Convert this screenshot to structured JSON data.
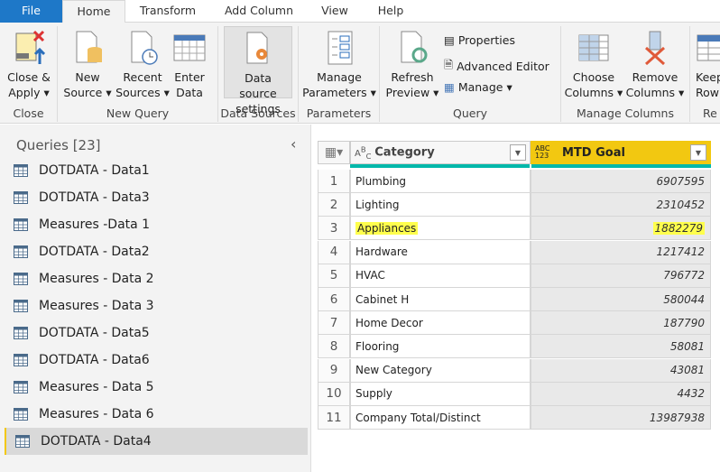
{
  "tabs": [
    "File",
    "Home",
    "Transform",
    "Add Column",
    "View",
    "Help"
  ],
  "ribbon": {
    "close": {
      "label1": "Close &",
      "label2": "Apply",
      "group": "Close"
    },
    "new_query": {
      "group": "New Query",
      "new_source": [
        "New",
        "Source"
      ],
      "recent_sources": [
        "Recent",
        "Sources"
      ],
      "enter_data": [
        "Enter",
        "Data"
      ]
    },
    "data_sources": {
      "group": "Data Sources",
      "settings": [
        "Data source",
        "settings"
      ]
    },
    "parameters": {
      "group": "Parameters",
      "manage": [
        "Manage",
        "Parameters"
      ]
    },
    "query": {
      "group": "Query",
      "refresh": [
        "Refresh",
        "Preview"
      ],
      "properties": "Properties",
      "advanced_editor": "Advanced Editor",
      "manage": "Manage"
    },
    "manage_columns": {
      "group": "Manage Columns",
      "choose": [
        "Choose",
        "Columns"
      ],
      "remove": [
        "Remove",
        "Columns"
      ]
    },
    "reduce": {
      "keep": [
        "Keep",
        "Row"
      ],
      "group": "Re"
    }
  },
  "queries": {
    "title": "Queries [23]",
    "items": [
      "DOTDATA - Data1",
      "DOTDATA - Data3",
      "Measures -Data 1",
      "DOTDATA - Data2",
      "Measures - Data 2",
      "Measures - Data 3",
      "DOTDATA - Data5",
      "DOTDATA - Data6",
      "Measures - Data 5",
      "Measures - Data 6",
      "DOTDATA - Data4"
    ],
    "selected": 10
  },
  "table": {
    "columns": [
      {
        "type": "ABC",
        "name": "Category"
      },
      {
        "type": "ABC 123",
        "name": "MTD Goal"
      }
    ],
    "rows": [
      [
        "1",
        "Plumbing",
        "6907595"
      ],
      [
        "2",
        "Lighting",
        "2310452"
      ],
      [
        "3",
        "Appliances",
        "1882279"
      ],
      [
        "4",
        "Hardware",
        "1217412"
      ],
      [
        "5",
        "HVAC",
        "796772"
      ],
      [
        "6",
        "Cabinet H",
        "580044"
      ],
      [
        "7",
        "Home Decor",
        "187790"
      ],
      [
        "8",
        "Flooring",
        "58081"
      ],
      [
        "9",
        "New Category",
        "43081"
      ],
      [
        "10",
        "Supply",
        "4432"
      ],
      [
        "11",
        "Company Total/Distinct",
        "13987938"
      ]
    ],
    "highlighted_row": 2,
    "accent": "#f2c811",
    "quality_bar": "#01b8aa",
    "highlight": "#ffff4d"
  }
}
